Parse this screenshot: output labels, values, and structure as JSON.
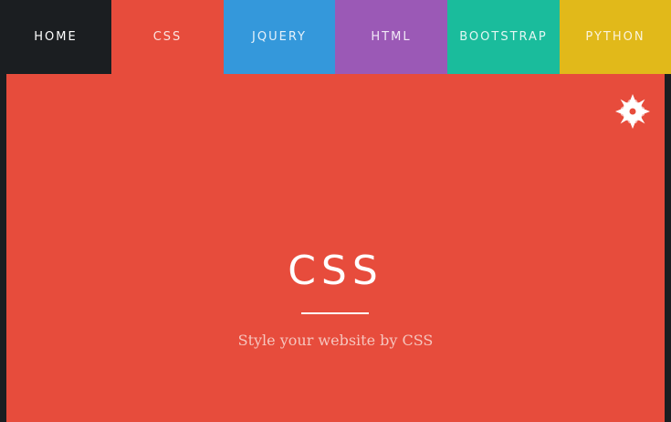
{
  "nav": {
    "items": [
      {
        "label": "HOME"
      },
      {
        "label": "CSS"
      },
      {
        "label": "JQUERY"
      },
      {
        "label": "HTML"
      },
      {
        "label": "BOOTSTRAP"
      },
      {
        "label": "PYTHON"
      }
    ],
    "active": "CSS"
  },
  "hero": {
    "title": "CSS",
    "subtitle": "Style your website by CSS"
  },
  "settings": {
    "icon": "gear-icon"
  },
  "colors": {
    "home": "#1b1e21",
    "css": "#e74c3c",
    "jquery": "#3498db",
    "html": "#9b59b6",
    "bootstrap": "#1abc9c",
    "python": "#e1b91a"
  }
}
